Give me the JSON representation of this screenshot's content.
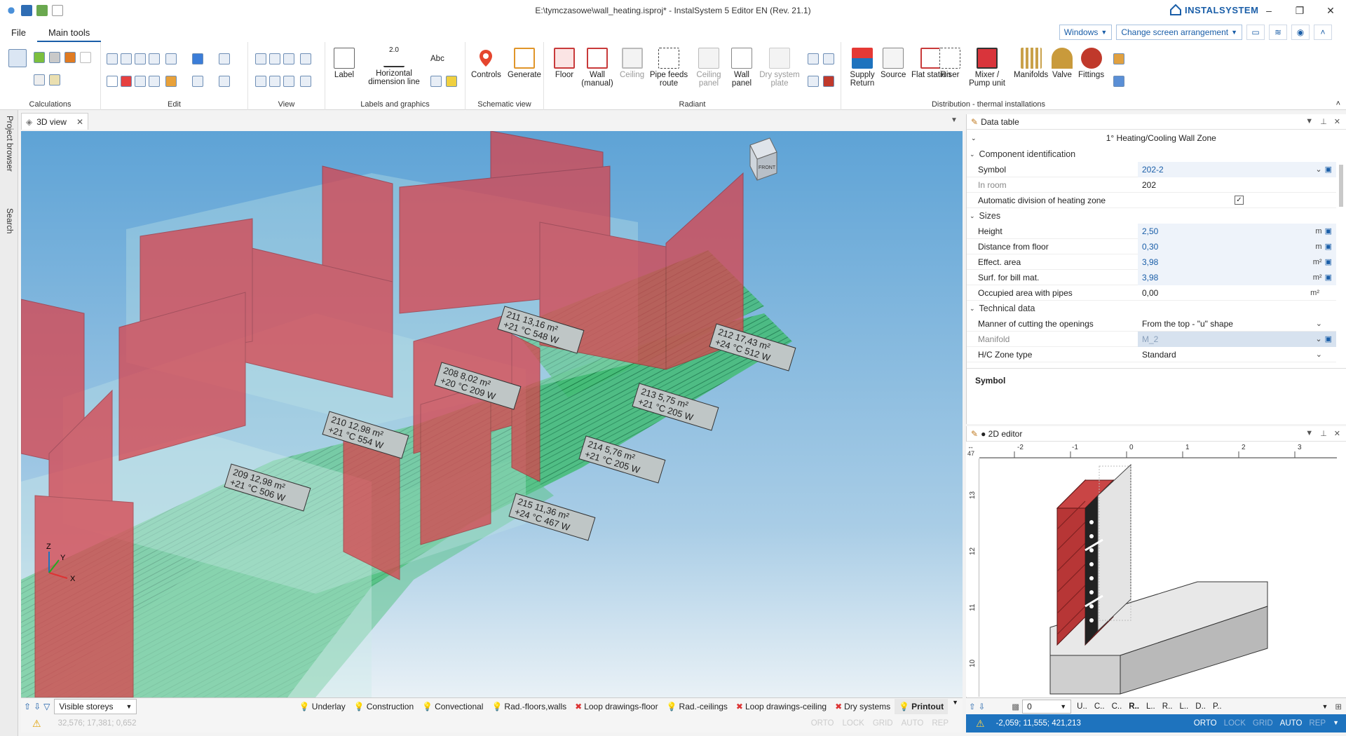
{
  "window": {
    "title": "E:\\tymczasowe\\wall_heating.isproj* - InstalSystem 5 Editor EN (Rev. 21.1)",
    "brand": "INSTALSYSTEM",
    "minimize": "–",
    "restore": "❐",
    "close": "✕"
  },
  "menu": {
    "tabs": [
      "File",
      "Main tools"
    ],
    "windows_label": "Windows",
    "arrangement_label": "Change screen arrangement"
  },
  "ribbon": {
    "groups": {
      "calculations": "Calculations",
      "edit": "Edit",
      "view": "View",
      "labels": "Labels and graphics",
      "schematic": "Schematic view",
      "radiant": "Radiant",
      "distribution": "Distribution - thermal installations"
    },
    "buttons": {
      "label": "Label",
      "hdim": "Horizontal dimension line",
      "abc": "Abc",
      "controls": "Controls",
      "generate": "Generate",
      "floor": "Floor",
      "wall_manual": "Wall (manual)",
      "ceiling": "Ceiling",
      "pipe_feeds": "Pipe feeds route",
      "ceiling_panel": "Ceiling panel",
      "wall_panel": "Wall panel",
      "dry_system": "Dry system plate",
      "supply_return": "Supply Return",
      "source": "Source",
      "flat_station": "Flat station",
      "riser": "Riser",
      "mixer": "Mixer / Pump unit",
      "manifolds": "Manifolds",
      "valve": "Valve",
      "fittings": "Fittings"
    },
    "hdim_value": "2.0"
  },
  "side": {
    "project_browser": "Project browser",
    "search": "Search"
  },
  "view3d": {
    "tab": "3D view",
    "cube_label": "FRONT",
    "room_labels": [
      "211 13,16 m² +21 °C 548 W",
      "208 8,02 m² +20 °C 209 W",
      "210 12,98 m² +21 °C 554 W",
      "209 12,98 m² +21 °C 506 W",
      "212 17,43 m² +24 °C 512 W",
      "213 5,75 m² +21 °C 205 W",
      "214 5,76 m² +21 °C 205 W",
      "215 11,36 m² +24 °C 467 W"
    ],
    "axis": {
      "x": "X",
      "y": "Y",
      "z": "Z"
    }
  },
  "view_toolbar": {
    "visible_storeys": "Visible storeys",
    "layers": [
      {
        "label": "Underlay",
        "state": "on"
      },
      {
        "label": "Construction",
        "state": "on"
      },
      {
        "label": "Convectional",
        "state": "on"
      },
      {
        "label": "Rad.-floors,walls",
        "state": "on"
      },
      {
        "label": "Loop drawings-floor",
        "state": "off"
      },
      {
        "label": "Rad.-ceilings",
        "state": "on"
      },
      {
        "label": "Loop drawings-ceiling",
        "state": "off"
      },
      {
        "label": "Dry systems",
        "state": "off"
      },
      {
        "label": "Printout",
        "state": "active"
      }
    ]
  },
  "status_left": {
    "coords": "32,576; 17,381; 0,652",
    "modes": [
      "ORTO",
      "LOCK",
      "GRID",
      "AUTO",
      "REP"
    ]
  },
  "data_table": {
    "panel_title": "Data table",
    "object_title": "1° Heating/Cooling Wall Zone",
    "sections": {
      "ident": "Component identification",
      "sizes": "Sizes",
      "tech": "Technical data"
    },
    "rows": {
      "symbol": {
        "name": "Symbol",
        "value": "202-2"
      },
      "in_room": {
        "name": "In room",
        "value": "202"
      },
      "auto_div": {
        "name": "Automatic division of heating zone",
        "value": "✓"
      },
      "height": {
        "name": "Height",
        "value": "2,50",
        "unit": "m"
      },
      "dist_floor": {
        "name": "Distance from floor",
        "value": "0,30",
        "unit": "m"
      },
      "eff_area": {
        "name": "Effect. area",
        "value": "3,98",
        "unit": "m²"
      },
      "surf_bill": {
        "name": "Surf. for bill mat.",
        "value": "3,98",
        "unit": "m²"
      },
      "occupied": {
        "name": "Occupied area with pipes",
        "value": "0,00",
        "unit": "m²"
      },
      "cutting": {
        "name": "Manner of cutting the openings",
        "value": "From the top - \"u\" shape"
      },
      "manifold": {
        "name": "Manifold",
        "value": "M_2"
      },
      "zone_type": {
        "name": "H/C Zone type",
        "value": "Standard"
      }
    },
    "description_title": "Symbol"
  },
  "editor2d": {
    "panel_title": "● 2D editor",
    "ruler_top": [
      "-2",
      "-1",
      "0",
      "1",
      "2",
      "3"
    ],
    "ruler_left": [
      "13",
      "12",
      "11",
      "10"
    ],
    "ruler_corner": "47",
    "layer_value": "0",
    "layer_tabs": [
      "U..",
      "C..",
      "C..",
      "R..",
      "L..",
      "R..",
      "L..",
      "D..",
      "P.."
    ],
    "coords": "-2,059; 11,555; 421,213",
    "modes": [
      "ORTO",
      "LOCK",
      "GRID",
      "AUTO",
      "REP"
    ]
  },
  "colors": {
    "accent": "#1a5ea8",
    "status_blue": "#1e73be",
    "wall_red": "#d9434c",
    "floor_green": "#3db86a",
    "sky_top": "#5ea3d6"
  }
}
